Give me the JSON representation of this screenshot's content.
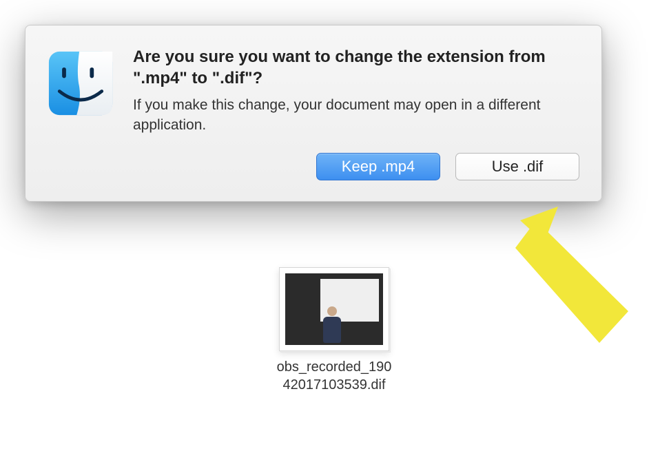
{
  "dialog": {
    "title": "Are you sure you want to change the extension from \".mp4\" to \".dif\"?",
    "message": "If you make this change, your document may open in a different application.",
    "primary_button": "Keep .mp4",
    "secondary_button": "Use .dif"
  },
  "file": {
    "name_line1": "obs_recorded_190",
    "name_line2": "42017103539.dif"
  }
}
